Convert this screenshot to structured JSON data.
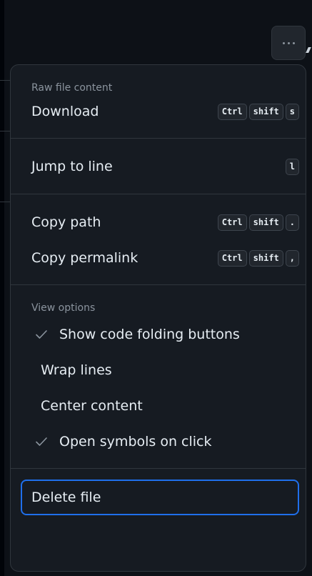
{
  "menu": {
    "sections": {
      "raw": {
        "header": "Raw file content",
        "download": {
          "label": "Download",
          "keys": [
            "Ctrl",
            "shift",
            "s"
          ]
        }
      },
      "jump": {
        "label": "Jump to line",
        "keys": [
          "l"
        ]
      },
      "copy": {
        "copy_path": {
          "label": "Copy path",
          "keys": [
            "Ctrl",
            "shift",
            "."
          ]
        },
        "copy_permalink": {
          "label": "Copy permalink",
          "keys": [
            "Ctrl",
            "shift",
            ","
          ]
        }
      },
      "view": {
        "header": "View options",
        "items": [
          {
            "label": "Show code folding buttons",
            "checked": true
          },
          {
            "label": "Wrap lines",
            "checked": false
          },
          {
            "label": "Center content",
            "checked": false
          },
          {
            "label": "Open symbols on click",
            "checked": true
          }
        ]
      },
      "danger": {
        "delete_label": "Delete file"
      }
    }
  },
  "icons": {
    "more": "kebab-horizontal-icon",
    "check": "check-icon"
  },
  "colors": {
    "background": "#0d1117",
    "menu_bg": "#161b22",
    "border": "#30363d",
    "text": "#e6edf3",
    "muted": "#8b949e",
    "focus": "#1f6feb"
  }
}
